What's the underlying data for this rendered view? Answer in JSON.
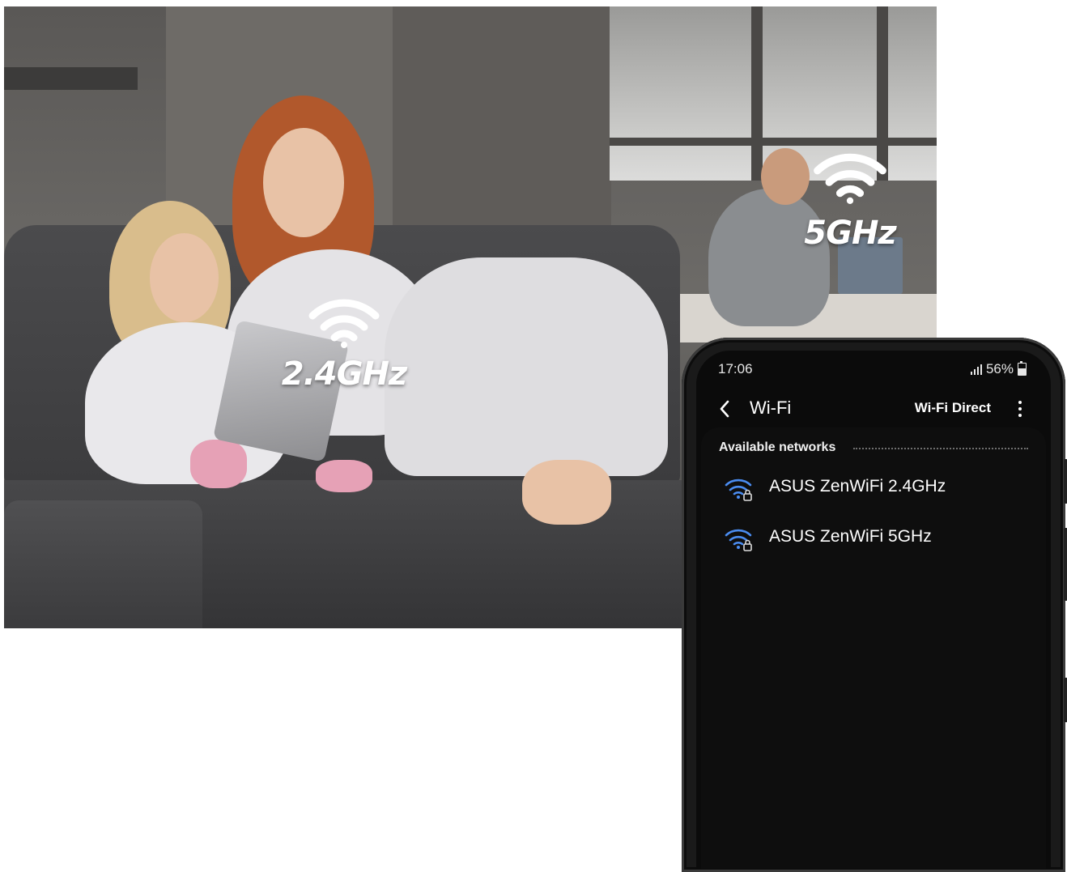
{
  "photo": {
    "badges": [
      {
        "label": "2.4GHz",
        "icon": "wifi-icon"
      },
      {
        "label": "5GHz",
        "icon": "wifi-icon"
      }
    ]
  },
  "phone": {
    "status": {
      "time": "17:06",
      "battery": "56%",
      "battery_level": 0.56,
      "signal_icon": "signal-icon"
    },
    "app_bar": {
      "title": "Wi-Fi",
      "action": "Wi-Fi Direct",
      "back_icon": "chevron-left-icon",
      "more_icon": "more-vertical-icon"
    },
    "section_header": "Available networks",
    "networks": [
      {
        "name": "ASUS ZenWiFi 2.4GHz",
        "icon": "wifi-lock-icon"
      },
      {
        "name": "ASUS ZenWiFi 5GHz",
        "icon": "wifi-lock-icon"
      }
    ],
    "accent_color": "#4a8cf0"
  }
}
